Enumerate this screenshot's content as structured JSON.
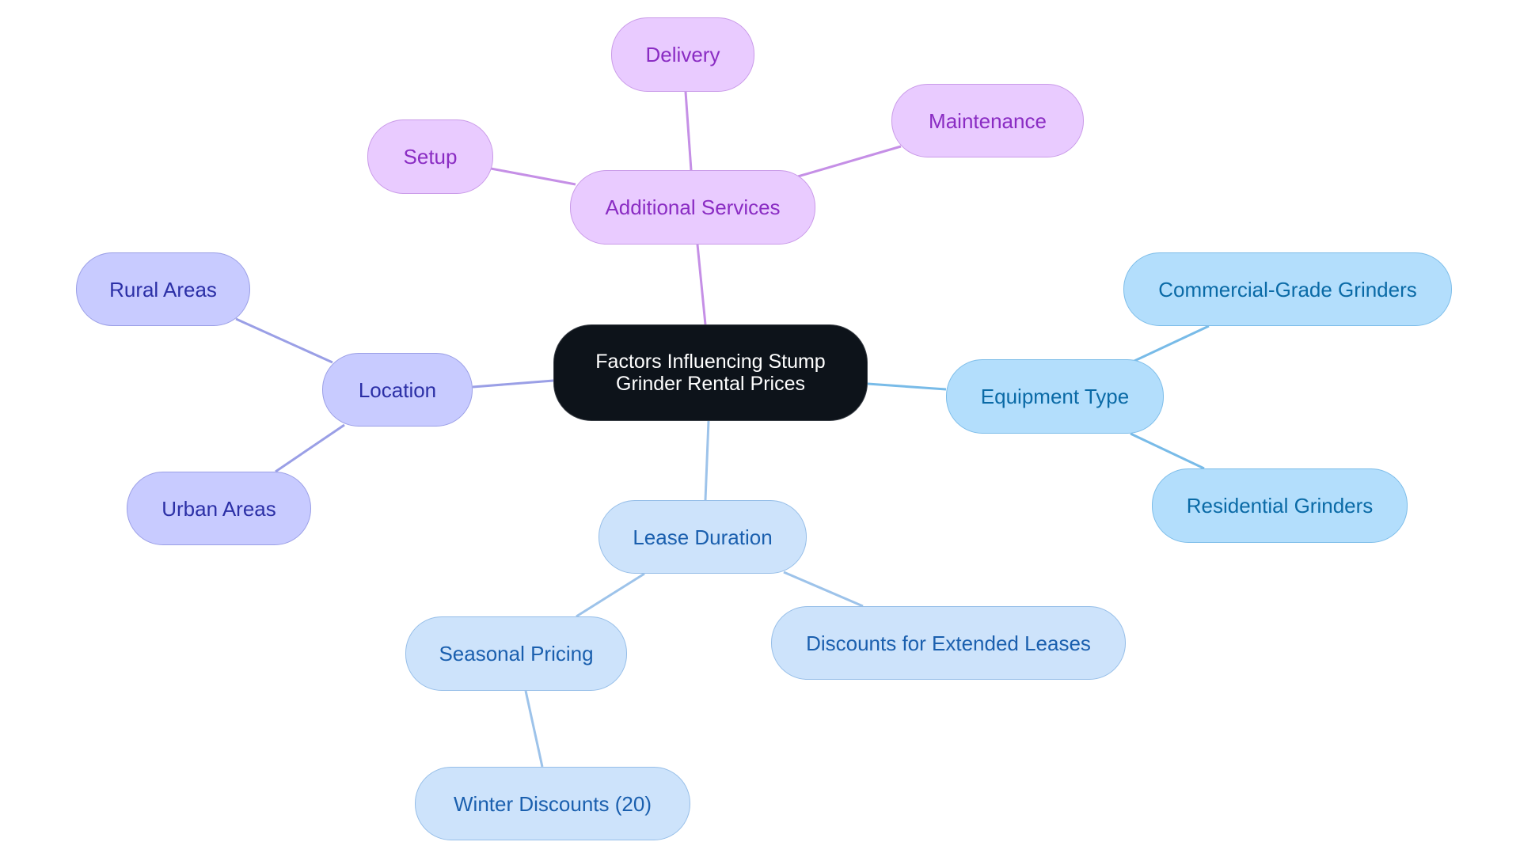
{
  "diagram": {
    "type": "mind-map",
    "root": {
      "id": "root",
      "label": "Factors Influencing Stump Grinder Rental Prices"
    },
    "colors": {
      "additional_services": "#c58fe6",
      "location": "#9a9fe6",
      "equipment_type": "#78bbe8",
      "lease_duration": "#9dc3ea",
      "root_fill": "#0d131a"
    },
    "nodes": [
      {
        "id": "additional-services",
        "label": "Additional Services",
        "parent": "root"
      },
      {
        "id": "delivery",
        "label": "Delivery",
        "parent": "additional-services"
      },
      {
        "id": "maintenance",
        "label": "Maintenance",
        "parent": "additional-services"
      },
      {
        "id": "setup",
        "label": "Setup",
        "parent": "additional-services"
      },
      {
        "id": "location",
        "label": "Location",
        "parent": "root"
      },
      {
        "id": "rural-areas",
        "label": "Rural Areas",
        "parent": "location"
      },
      {
        "id": "urban-areas",
        "label": "Urban Areas",
        "parent": "location"
      },
      {
        "id": "equipment-type",
        "label": "Equipment Type",
        "parent": "root"
      },
      {
        "id": "commercial-grade-grinders",
        "label": "Commercial-Grade Grinders",
        "parent": "equipment-type"
      },
      {
        "id": "residential-grinders",
        "label": "Residential Grinders",
        "parent": "equipment-type"
      },
      {
        "id": "lease-duration",
        "label": "Lease Duration",
        "parent": "root"
      },
      {
        "id": "seasonal-pricing",
        "label": "Seasonal Pricing",
        "parent": "lease-duration"
      },
      {
        "id": "discounts-extended-leases",
        "label": "Discounts for Extended Leases",
        "parent": "lease-duration"
      },
      {
        "id": "winter-discounts",
        "label": "Winter Discounts (20)",
        "parent": "seasonal-pricing"
      }
    ]
  }
}
